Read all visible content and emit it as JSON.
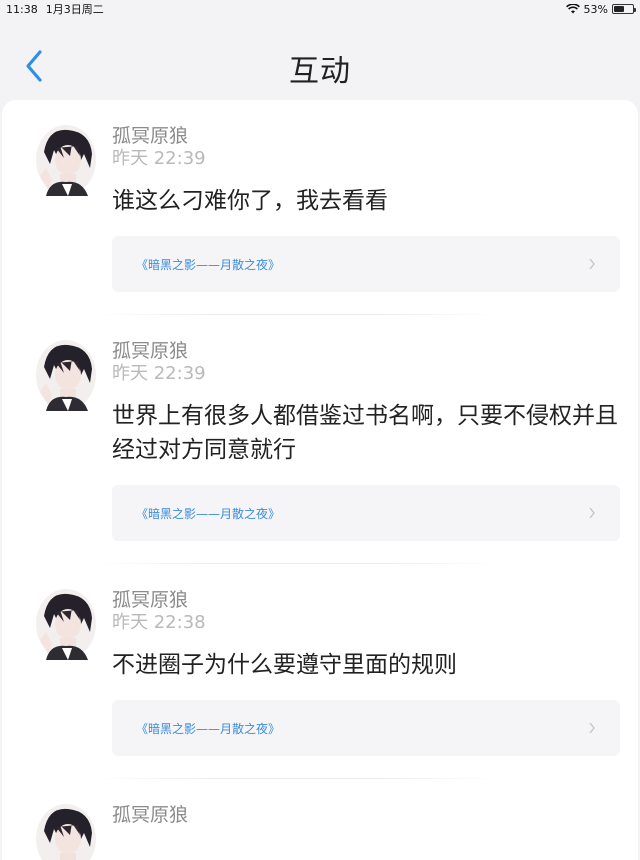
{
  "status_bar": {
    "time": "11:38",
    "date": "1月3日周二",
    "battery": "53%",
    "battery_level": 0.53
  },
  "header": {
    "title": "互动",
    "back_icon": "chevron-left-icon",
    "accent_color": "#2f8fe6"
  },
  "comments": [
    {
      "user": "孤冥原狼",
      "time": "昨天 22:39",
      "text": "谁这么刁难你了，我去看看",
      "book": "《暗黑之影——月散之夜》"
    },
    {
      "user": "孤冥原狼",
      "time": "昨天 22:39",
      "text": "世界上有很多人都借鉴过书名啊，只要不侵权并且经过对方同意就行",
      "book": "《暗黑之影——月散之夜》"
    },
    {
      "user": "孤冥原狼",
      "time": "昨天 22:38",
      "text": "不进圈子为什么要遵守里面的规则",
      "book": "《暗黑之影——月散之夜》"
    },
    {
      "user": "孤冥原狼",
      "time": "",
      "text": "",
      "book": ""
    }
  ]
}
